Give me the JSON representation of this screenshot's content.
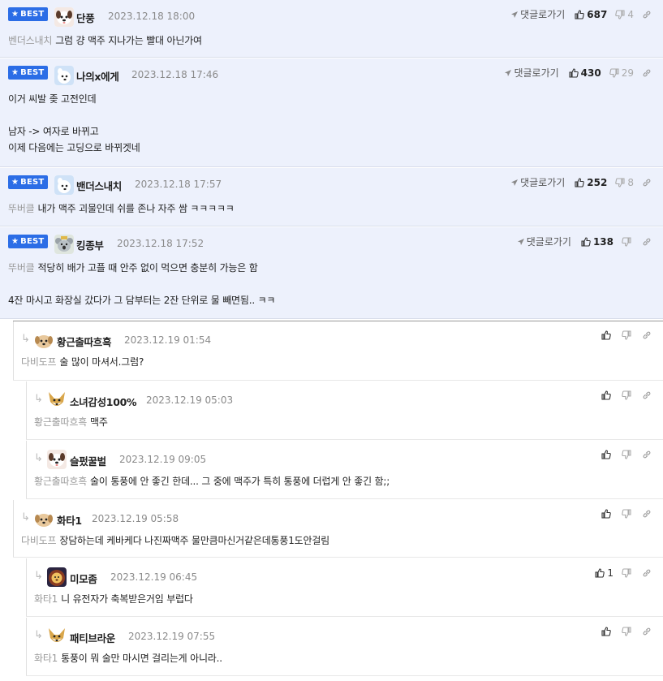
{
  "labels": {
    "best": "BEST",
    "reply": "댓글로가기"
  },
  "colors": {
    "best_bg": "#edf1fc",
    "badge": "#2b6de6"
  },
  "comments": [
    {
      "nick": "단풍",
      "date": "2023.12.18 18:00",
      "to": "벤더스내치",
      "text": "그럼 걍 맥주 지나가는 빨대 아닌가여",
      "up": "687",
      "down": "4",
      "avatar": "dog-face"
    },
    {
      "nick": "나의x에게",
      "date": "2023.12.18 17:46",
      "to": "",
      "text": "이거 씨발 좆 고전인데\n\n남자 -> 여자로 바뀌고\n이제 다음에는 고딩으로 바뀌겟네",
      "up": "430",
      "down": "29",
      "avatar": "white-dog"
    },
    {
      "nick": "밴더스내치",
      "date": "2023.12.18 17:57",
      "to": "뚜버클",
      "text": "내가 맥주 괴물인데 쉬를 존나 자주 쌈 ㅋㅋㅋㅋㅋ",
      "up": "252",
      "down": "8",
      "avatar": "white-dog"
    },
    {
      "nick": "킹종부",
      "date": "2023.12.18 17:52",
      "to": "뚜버클",
      "text": "적당히 배가 고플 때 안주 없이 먹으면 충분히 가능은 함\n\n4잔 마시고 화장실 갔다가 그 담부터는 2잔 단위로 물 빼면됨.. ㅋㅋ",
      "up": "138",
      "down": "",
      "avatar": "koala"
    }
  ],
  "replies": [
    {
      "nick": "황근출따흐흑",
      "date": "2023.12.19 01:54",
      "to": "다비도프",
      "text": "술 많이 마셔서.그럼?",
      "up": "",
      "avatar": "puppy"
    },
    {
      "nick": "소녀감성100%",
      "date": "2023.12.19 05:03",
      "to": "황근출따흐흑",
      "text": "맥주",
      "up": "",
      "avatar": "fox"
    },
    {
      "nick": "슬펐꿀벌",
      "date": "2023.12.19 09:05",
      "to": "황근출따흐흑",
      "text": "술이 통풍에 안 좋긴 한데... 그 중에 맥주가 특히 통풍에 더럽게 안 좋긴 함;;",
      "up": "",
      "avatar": "dog-face"
    },
    {
      "nick": "화타1",
      "date": "2023.12.19 05:58",
      "to": "다비도프",
      "text": "장담하는데 케바케다 나진짜맥주 물만큼마신거같은데통풍1도안걸림",
      "up": "",
      "avatar": "puppy"
    },
    {
      "nick": "미모좀",
      "date": "2023.12.19 06:45",
      "to": "화타1",
      "text": "니 유전자가 축복받은거임 부럽다",
      "up": "1",
      "avatar": "lion"
    },
    {
      "nick": "패티브라운",
      "date": "2023.12.19 07:55",
      "to": "화타1",
      "text": "통풍이 뭐 술만 마시면 걸리는게 아니라..",
      "up": "",
      "avatar": "fox"
    }
  ]
}
